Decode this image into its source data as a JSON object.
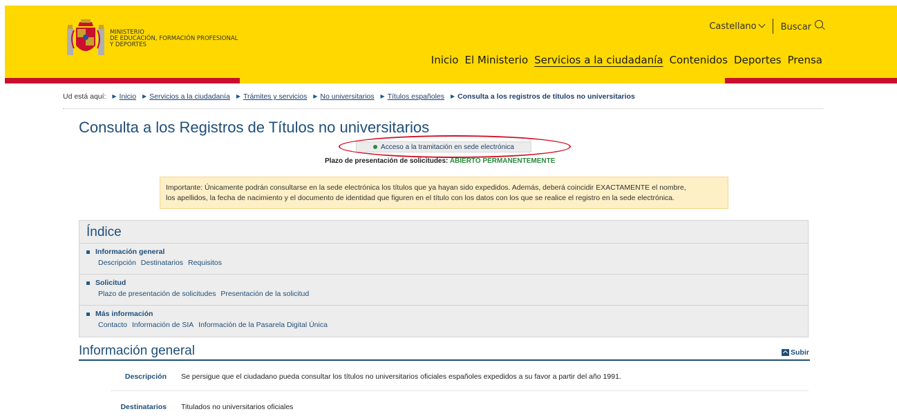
{
  "header": {
    "ministry_lines": [
      "Ministerio",
      "de Educación, Formación Profesional",
      "y Deportes"
    ],
    "language": "Castellano",
    "search_label": "Buscar",
    "nav": [
      "Inicio",
      "El Ministerio",
      "Servicios a la ciudadanía",
      "Contenidos",
      "Deportes",
      "Prensa"
    ],
    "active_nav": "Servicios a la ciudadanía",
    "colors": {
      "yellow": "#ffd800",
      "red": "#c8102e"
    }
  },
  "breadcrumb": {
    "label": "Ud está aquí:",
    "items": [
      "Inicio",
      "Servicios a la ciudadanía",
      "Trámites y servicios",
      "No universitarios",
      "Títulos españoles"
    ],
    "current": "Consulta a los registros de títulos no universitarios"
  },
  "page": {
    "title": "Consulta a los Registros de Títulos no universitarios",
    "access_button": "Acceso a la tramitación en sede electrónica",
    "plazo_label": "Plazo de presentación de solicitudes:",
    "plazo_status": "ABIERTO PERMANENTEMENTE",
    "important_line1": "Importante: Únicamente podrán consultarse en la sede electrónica los títulos que ya hayan sido expedidos. Además, deberá coincidir EXACTAMENTE el nombre,",
    "important_line2": "los apellidos, la fecha de nacimiento y el documento de identidad que figuren en el título con los datos con los que se realice el registro en la sede electrónica."
  },
  "indice": {
    "title": "Índice",
    "sections": [
      {
        "heading": "Información general",
        "links": [
          "Descripción",
          "Destinatarios",
          "Requisitos"
        ]
      },
      {
        "heading": "Solicitud",
        "links": [
          "Plazo de presentación de solicitudes",
          "Presentación de la solicitud"
        ]
      },
      {
        "heading": "Más información",
        "links": [
          "Contacto",
          "Información de SIA",
          "Información de la Pasarela Digital Única"
        ]
      }
    ]
  },
  "info_general": {
    "title": "Información general",
    "subir": "Subir",
    "rows": [
      {
        "term": "Descripción",
        "def": "Se persigue que el ciudadano pueda consultar los títulos no universitarios oficiales españoles expedidos a su favor a partir del año 1991."
      },
      {
        "term": "Destinatarios",
        "def": "Titulados no universitarios oficiales"
      }
    ]
  }
}
